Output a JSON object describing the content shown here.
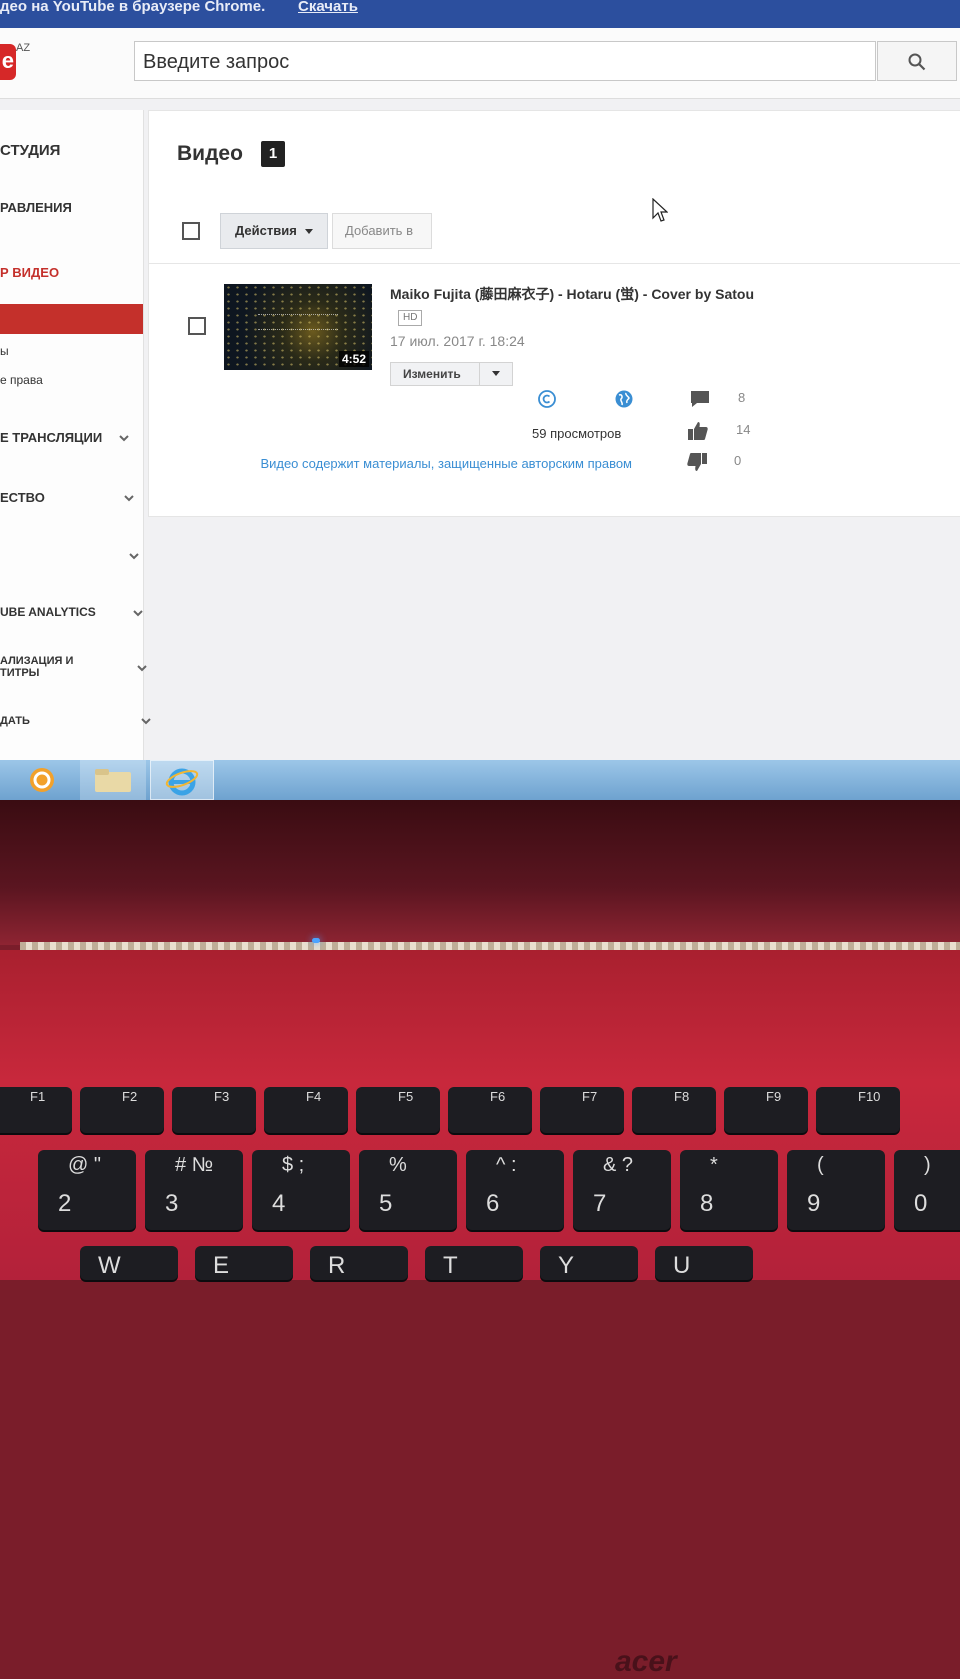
{
  "browser": {
    "promo_text": "део на YouTube в браузере Chrome.",
    "promo_link": "Скачать"
  },
  "header": {
    "logo_suffix": "AZ",
    "search_placeholder": "Введите запрос"
  },
  "sidebar": {
    "items": [
      {
        "label": "СТУДИЯ"
      },
      {
        "label": "РАВЛЕНИЯ"
      },
      {
        "label": "Р ВИДЕО"
      },
      {
        "label": "ы"
      },
      {
        "label": "е права"
      },
      {
        "label": "Е ТРАНСЛЯЦИИ"
      },
      {
        "label": "ЕСТВО"
      },
      {
        "label": ""
      },
      {
        "label": "UBE ANALYTICS"
      },
      {
        "label": "АЛИЗАЦИЯ И"
      },
      {
        "label": "ТИТРЫ"
      },
      {
        "label": "ДАТЬ"
      }
    ]
  },
  "main": {
    "title": "Видео",
    "count": "1",
    "actions_label": "Действия",
    "add_label": "Добавить в"
  },
  "video": {
    "title": "Maiko Fujita (藤田麻衣子) - Hotaru (蛍) - Cover by Satou",
    "hd_badge": "HD",
    "date": "17 июл. 2017 г. 18:24",
    "duration": "4:52",
    "edit_label": "Изменить",
    "views": "59 просмотров",
    "copyright_notice": "Видео содержит материалы, защищенные авторским правом",
    "comments": "8",
    "likes": "14",
    "dislikes": "0"
  },
  "laptop": {
    "brand": "acer",
    "fkeys": [
      "F1",
      "F2",
      "F3",
      "F4",
      "F5",
      "F6",
      "F7",
      "F8",
      "F9",
      "F10"
    ],
    "number_keys": [
      {
        "top": "@  \"",
        "main": "2"
      },
      {
        "top": "#  №",
        "main": "3"
      },
      {
        "top": "$  ;",
        "main": "4"
      },
      {
        "top": "%",
        "main": "5"
      },
      {
        "top": "^  :",
        "main": "6"
      },
      {
        "top": "&  ?",
        "main": "7"
      },
      {
        "top": "*",
        "main": "8"
      },
      {
        "top": "(",
        "main": "9"
      },
      {
        "top": ")",
        "main": "0"
      }
    ],
    "letter_keys": [
      "W",
      "E",
      "R",
      "T",
      "Y",
      "U"
    ]
  }
}
